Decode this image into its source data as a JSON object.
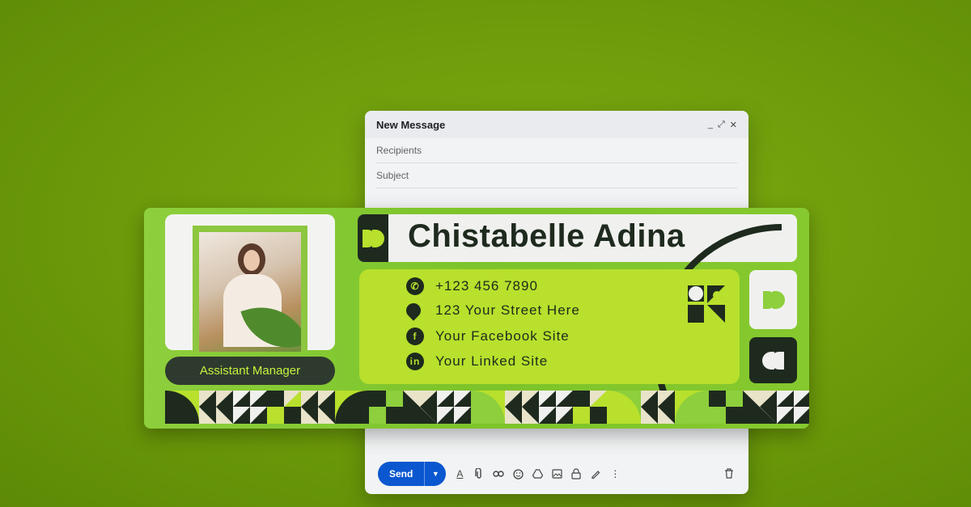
{
  "compose": {
    "title": "New Message",
    "controls": [
      "_",
      "⤢",
      "✕"
    ],
    "recipients_placeholder": "Recipients",
    "subject_placeholder": "Subject",
    "send_label": "Send"
  },
  "signature": {
    "name": "Chistabelle Adina",
    "role": "Assistant Manager",
    "contacts": [
      {
        "icon": "whatsapp-icon",
        "text": "+123 456 7890"
      },
      {
        "icon": "location-icon",
        "text": "123 Your Street Here"
      },
      {
        "icon": "facebook-icon",
        "text": "Your Facebook Site"
      },
      {
        "icon": "linkedin-icon",
        "text": "Your Linked Site"
      }
    ]
  },
  "colors": {
    "background": "#6c9a0a",
    "card_green": "#7cc42a",
    "lime": "#b8e02c",
    "dark": "#1e2a1e",
    "send_blue": "#0b57d0"
  }
}
